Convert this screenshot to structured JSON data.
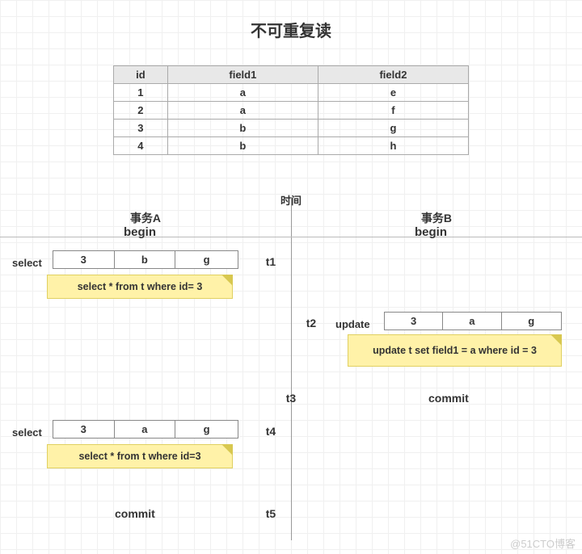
{
  "title": "不可重复读",
  "table": {
    "headers": [
      "id",
      "field1",
      "field2"
    ],
    "rows": [
      [
        "1",
        "a",
        "e"
      ],
      [
        "2",
        "a",
        "f"
      ],
      [
        "3",
        "b",
        "g"
      ],
      [
        "4",
        "b",
        "h"
      ]
    ]
  },
  "timeline": {
    "time_label": "时间",
    "txn_a": "事务A",
    "txn_b": "事务B",
    "begin": "begin",
    "steps": {
      "t1": "t1",
      "t2": "t2",
      "t3": "t3",
      "t4": "t4",
      "t5": "t5"
    }
  },
  "ops": {
    "select": "select",
    "update": "update",
    "commit": "commit"
  },
  "rows_display": {
    "a_t1": [
      "3",
      "b",
      "g"
    ],
    "b_t2": [
      "3",
      "a",
      "g"
    ],
    "a_t4": [
      "3",
      "a",
      "g"
    ]
  },
  "sql": {
    "a_t1": "select * from t where id= 3",
    "b_t2": "update t set field1 = a where id = 3",
    "a_t4": "select * from t where id=3"
  },
  "watermark": "@51CTO博客"
}
